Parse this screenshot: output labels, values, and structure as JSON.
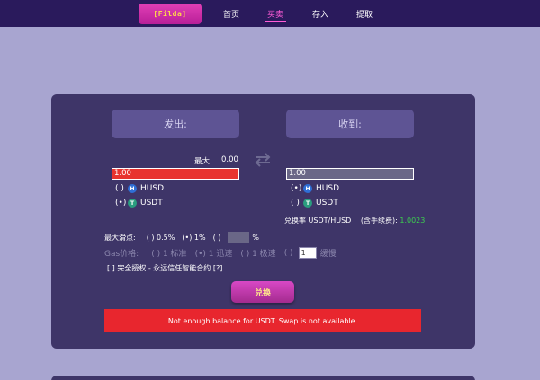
{
  "nav": {
    "brand": "[Filda]",
    "items": [
      "首页",
      "买卖",
      "存入",
      "提取"
    ],
    "active": "买卖"
  },
  "swap": {
    "from_label": "发出:",
    "to_label": "收到:",
    "max_label": "最大:",
    "max_value": "0.00",
    "from_amount": "1.00",
    "to_amount": "1.00",
    "from_tokens": [
      {
        "radio": "( )",
        "icon": "husd-icon",
        "symbol": "HUSD",
        "selected": false
      },
      {
        "radio": "(•)",
        "icon": "usdt-icon",
        "symbol": "USDT",
        "selected": true
      }
    ],
    "to_tokens": [
      {
        "radio": "(•)",
        "icon": "husd-icon",
        "symbol": "HUSD",
        "selected": true
      },
      {
        "radio": "( )",
        "icon": "usdt-icon",
        "symbol": "USDT",
        "selected": false
      }
    ],
    "rate_label": "兑换率 USDT/HUSD",
    "rate_fee_label": "(含手续费):",
    "rate_value": "1.0023",
    "slippage_label": "最大滑点:",
    "slippage_options": [
      "( ) 0.5%",
      "(•) 1%",
      "( )"
    ],
    "slippage_unit": "%",
    "gas_label": "Gas价格:",
    "gas_options": [
      "( ) 1 标准",
      "(•) 1 迅速",
      "( ) 1 极速",
      "( )"
    ],
    "gas_custom_value": "1",
    "gas_slow_label": "缓慢",
    "approve_text": "[ ]   完全授权 - 永远信任智能合约   [?]",
    "exchange_button": "兑换",
    "error_message": "Not enough balance for USDT. Swap is not available."
  },
  "colors": {
    "topbar": "#2a1a5c",
    "background": "#a8a5d0",
    "card": "#3e3568",
    "accent": "#ff5cd8",
    "error": "#e8262e",
    "rate_value": "#3ccf4f"
  }
}
